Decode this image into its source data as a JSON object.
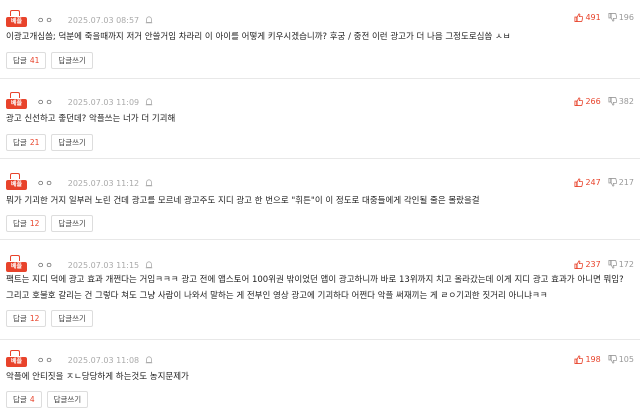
{
  "comments": [
    {
      "badge": "베플",
      "nick": "ㅇㅇ",
      "date": "2025.07.03 08:57",
      "up": "491",
      "down": "196",
      "text": "이광고개심씀; 덕분에 죽을때까지 저거 안쓸거임 차라리 이 아이를 어떻게 키우시겠습니까? 후궁 / 중전 이런 광고가 더 나음 그정도로심씀 ㅅㅂ",
      "reply_label": "답글",
      "reply_count": "41",
      "write_label": "답글쓰기"
    },
    {
      "badge": "베플",
      "nick": "ㅇㅇ",
      "date": "2025.07.03 11:09",
      "up": "266",
      "down": "382",
      "text": "광고 신선하고 좋던데? 악플쓰는 너가 더 기괴해",
      "reply_label": "답글",
      "reply_count": "21",
      "write_label": "답글쓰기"
    },
    {
      "badge": "베플",
      "nick": "ㅇㅇ",
      "date": "2025.07.03 11:12",
      "up": "247",
      "down": "217",
      "text": "뭐가 기괴한 거지 일부러 노린 건데 광고를 모르네 광고주도 지디 광고 한 번으로 \"휘튼\"이 이 정도로 대중들에게 각인될 줄은 몰랐을걸",
      "reply_label": "답글",
      "reply_count": "12",
      "write_label": "답글쓰기"
    },
    {
      "badge": "베플",
      "nick": "ㅇㅇ",
      "date": "2025.07.03 11:15",
      "up": "237",
      "down": "172",
      "text": "팩트는 지디 덕에 광고 효과 개쩐다는 거임ㅋㅋㅋ 광고 전에 앱스토어 100위권 밖이었던 앱이 광고하니까 바로 13위까지 치고 올라갔는데 이게 지디 광고 효과가 아니면 뭐임? 그리고 호불호 갈리는 건 그렇다 쳐도 그냥 사람이 나와서 말하는 게 전부인 영상 광고에 기괴하다 어쩐다 악플 써재끼는 게 ㄹㅇ기괴한 짓거리 아니냐ㅋㅋ",
      "reply_label": "답글",
      "reply_count": "12",
      "write_label": "답글쓰기"
    },
    {
      "badge": "베플",
      "nick": "ㅇㅇ",
      "date": "2025.07.03 11:08",
      "up": "198",
      "down": "105",
      "text": "악플에 안티짓을 ㅈㄴ당당하게 하는것도 농지문제가",
      "reply_label": "답글",
      "reply_count": "4",
      "write_label": "답글쓰기"
    }
  ],
  "colors": {
    "accent": "#e8432b",
    "muted": "#999999"
  }
}
